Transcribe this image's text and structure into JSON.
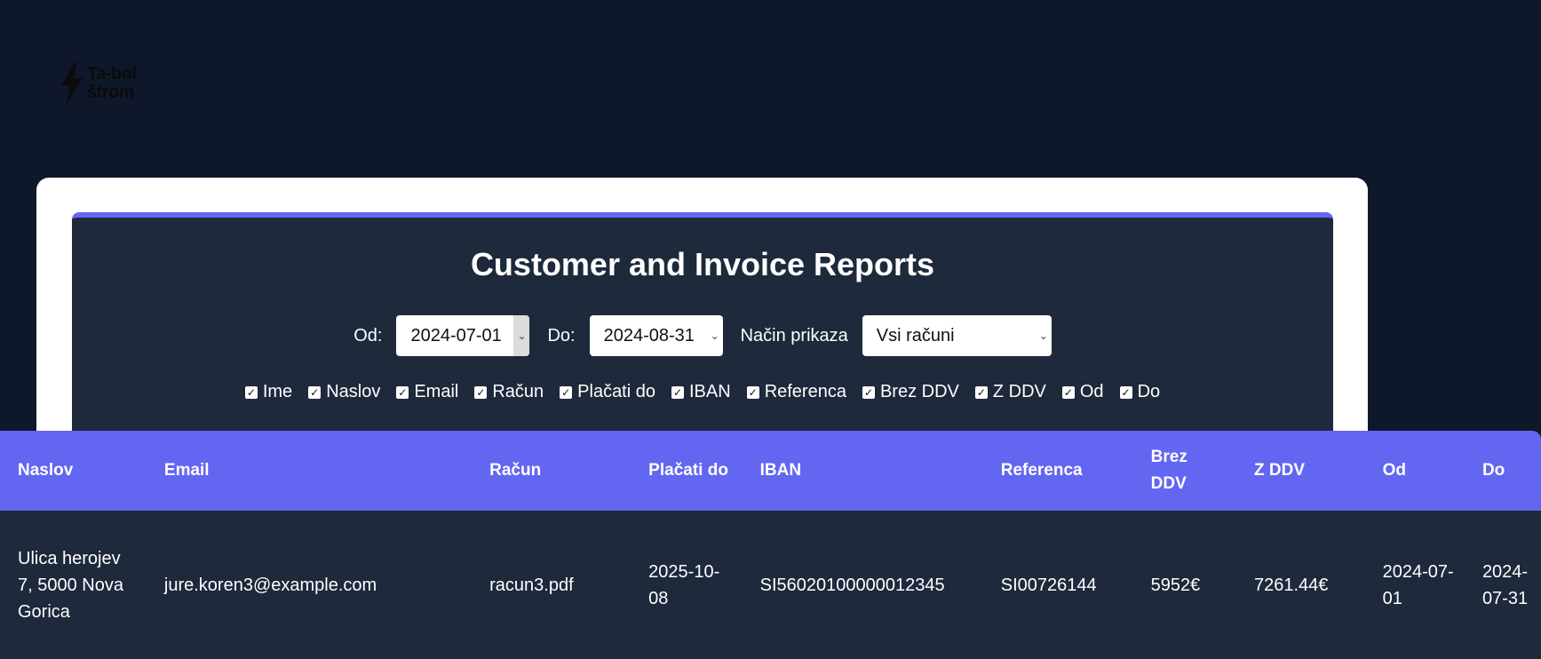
{
  "logo": {
    "icon": "lightning-bolt-icon",
    "line1": "Ta-bol",
    "line2": "štrom"
  },
  "page_title": "Customer and Invoice Reports",
  "filters": {
    "from_label": "Od:",
    "from_value": "2024-07-01",
    "to_label": "Do:",
    "to_value": "2024-08-31",
    "mode_label": "Način prikaza",
    "mode_value": "Vsi računi"
  },
  "columns_toggle": [
    {
      "label": "Ime",
      "checked": true
    },
    {
      "label": "Naslov",
      "checked": true
    },
    {
      "label": "Email",
      "checked": true
    },
    {
      "label": "Račun",
      "checked": true
    },
    {
      "label": "Plačati do",
      "checked": true
    },
    {
      "label": "IBAN",
      "checked": true
    },
    {
      "label": "Referenca",
      "checked": true
    },
    {
      "label": "Brez DDV",
      "checked": true
    },
    {
      "label": "Z DDV",
      "checked": true
    },
    {
      "label": "Od",
      "checked": true
    },
    {
      "label": "Do",
      "checked": true
    }
  ],
  "table": {
    "headers": [
      "Naslov",
      "Email",
      "Račun",
      "Plačati do",
      "IBAN",
      "Referenca",
      "Brez DDV",
      "Z DDV",
      "Od",
      "Do"
    ],
    "rows": [
      [
        "Ulica herojev 7, 5000 Nova Gorica",
        "jure.koren3@example.com",
        "racun3.pdf",
        "2025-10-08",
        "SI56020100000012345",
        "SI00726144",
        "5952€",
        "7261.44€",
        "2024-07-01",
        "2024-07-31"
      ]
    ]
  },
  "colors": {
    "background": "#0f172a",
    "panel": "#1e293b",
    "accent": "#6366f1",
    "card": "#ffffff"
  }
}
